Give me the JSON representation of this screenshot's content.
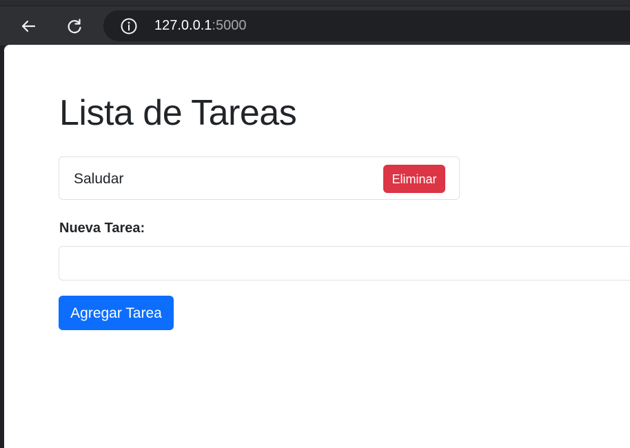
{
  "browser": {
    "url_host": "127.0.0.1",
    "url_port": ":5000",
    "back_icon": "arrow-left-icon",
    "reload_icon": "reload-icon",
    "info_icon": "info-icon"
  },
  "page": {
    "title": "Lista de Tareas",
    "tasks": [
      {
        "text": "Saludar",
        "delete_label": "Eliminar"
      }
    ],
    "new_task_label": "Nueva Tarea:",
    "new_task_value": "",
    "new_task_placeholder": "",
    "add_button_label": "Agregar Tarea"
  },
  "colors": {
    "primary": "#0d6efd",
    "danger": "#dc3545",
    "text": "#212529",
    "browser_toolbar": "#2f3034",
    "address_bar": "#1f2023"
  }
}
